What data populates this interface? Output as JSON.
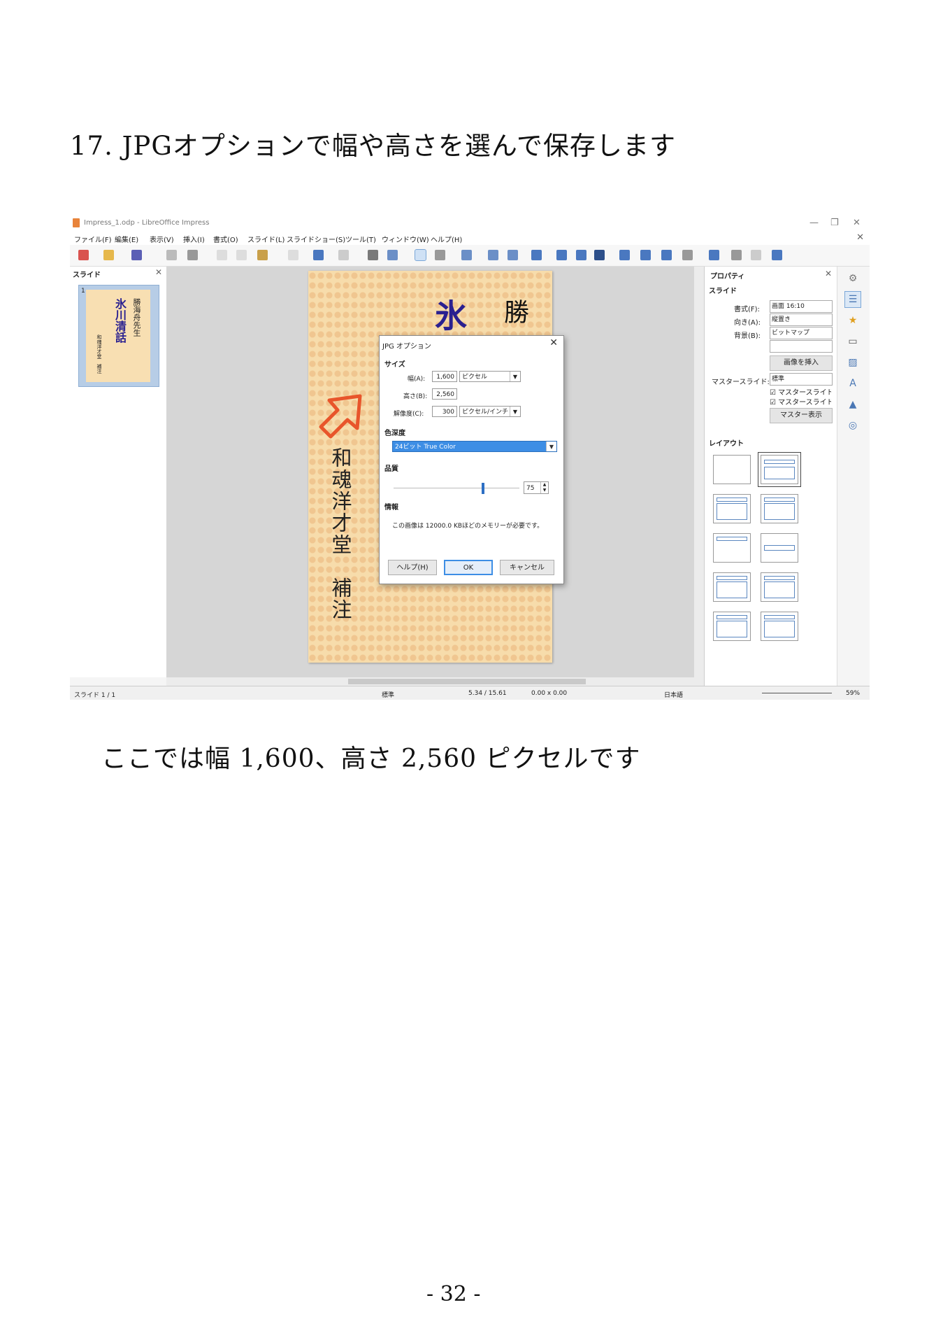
{
  "heading": "17. JPGオプションで幅や高さを選んで保存します",
  "caption": "ここでは幅 1,600、高さ 2,560 ピクセルです",
  "page_number": "- 32 -",
  "app": {
    "window_title": "Impress_1.odp - LibreOffice Impress",
    "window_buttons": {
      "minimize": "—",
      "restore": "❐",
      "close": "✕"
    },
    "menu": [
      "ファイル(F)",
      "編集(E)",
      "表示(V)",
      "挿入(I)",
      "書式(O)",
      "スライド(L)",
      "スライドショー(S)",
      "ツール(T)",
      "ウィンドウ(W)",
      "ヘルプ(H)"
    ],
    "slides_pane": {
      "title": "スライド",
      "thumb_number": "1"
    },
    "slide": {
      "title_main": "氷川清話",
      "author": "勝海舟先生",
      "side_text": "和魂洋才堂　補注",
      "visible_big1": "氷",
      "visible_big2": "勝"
    },
    "properties": {
      "title": "プロパティ",
      "slide_section": "スライド",
      "format_label": "書式(F):",
      "format_value": "画面 16:10",
      "orientation_label": "向き(A):",
      "orientation_value": "縦置き",
      "background_label": "背景(B):",
      "background_value": "ビットマップ",
      "insert_image_button": "画像を挿入",
      "master_label": "マスタースライド:",
      "master_value": "標準",
      "master_bg_check": "マスタースライドの背景",
      "master_obj_check": "マスタースライドのオブジェクト",
      "master_view_button": "マスター表示",
      "layout_section": "レイアウト"
    },
    "statusbar": {
      "slide": "スライド 1 / 1",
      "master": "標準",
      "position": "5.34 / 15.61",
      "size": "0.00 x 0.00",
      "language": "日本語",
      "zoom": "59%"
    },
    "dialog": {
      "title": "JPG オプション",
      "size_section": "サイズ",
      "width_label": "幅(A):",
      "width_value": "1,600",
      "width_unit": "ピクセル",
      "height_label": "高さ(B):",
      "height_value": "2,560",
      "resolution_label": "解像度(C):",
      "resolution_value": "300",
      "resolution_unit": "ピクセル/インチ",
      "color_depth_section": "色深度",
      "color_depth_value": "24ビット True Color",
      "quality_section": "品質",
      "quality_value": "75",
      "quality_level": 0.75,
      "info_section": "情報",
      "info_text": "この画像は 12000.0 KBほどのメモリーが必要です。",
      "help_button": "ヘルプ(H)",
      "ok_button": "OK",
      "cancel_button": "キャンセル"
    }
  }
}
